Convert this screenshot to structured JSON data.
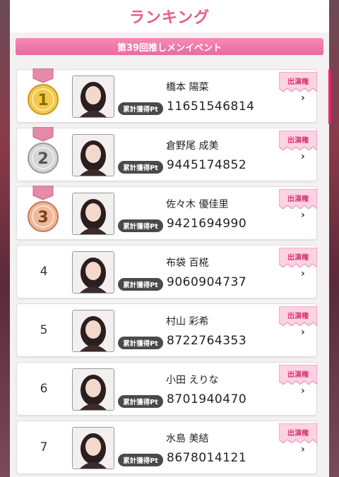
{
  "header": {
    "title": "ランキング"
  },
  "event": {
    "label": "第39回推しメンイベント"
  },
  "labels": {
    "points_badge": "累計獲得Pt",
    "appearance_ribbon": "出演権",
    "chevron": "›"
  },
  "colors": {
    "accent": "#e95a92",
    "gold": "#f2c94c",
    "silver": "#c9c9c9",
    "bronze": "#e0a080",
    "badge_bg": "#4a4a4a"
  },
  "ranking": [
    {
      "rank": "1",
      "name": "橋本 陽菜",
      "points": "11651546814",
      "medal": "gold"
    },
    {
      "rank": "2",
      "name": "倉野尾 成美",
      "points": "9445174852",
      "medal": "silver"
    },
    {
      "rank": "3",
      "name": "佐々木 優佳里",
      "points": "9421694990",
      "medal": "bronze"
    },
    {
      "rank": "4",
      "name": "布袋 百椛",
      "points": "9060904737",
      "medal": ""
    },
    {
      "rank": "5",
      "name": "村山 彩希",
      "points": "8722764353",
      "medal": ""
    },
    {
      "rank": "6",
      "name": "小田 えりな",
      "points": "8701940470",
      "medal": ""
    },
    {
      "rank": "7",
      "name": "水島 美結",
      "points": "8678014121",
      "medal": ""
    }
  ]
}
